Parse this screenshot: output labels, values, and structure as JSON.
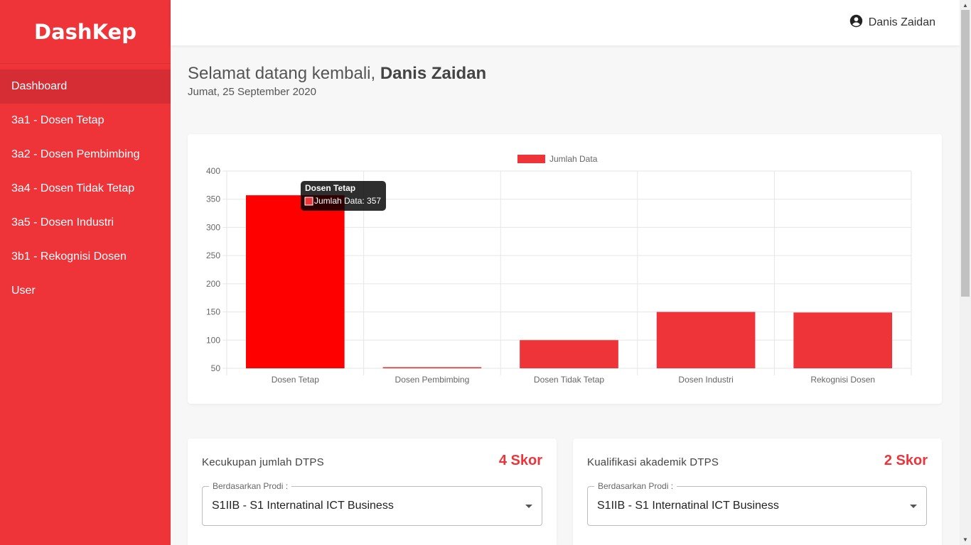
{
  "app": {
    "brand": "DashKep"
  },
  "sidebar": {
    "items": [
      {
        "label": "Dashboard",
        "active": true
      },
      {
        "label": "3a1 - Dosen Tetap"
      },
      {
        "label": "3a2 - Dosen Pembimbing"
      },
      {
        "label": "3a4 - Dosen Tidak Tetap"
      },
      {
        "label": "3a5 - Dosen Industri"
      },
      {
        "label": "3b1 - Rekognisi Dosen"
      },
      {
        "label": "User"
      }
    ]
  },
  "header": {
    "user_name": "Danis Zaidan",
    "user_icon": "account-circle-icon"
  },
  "welcome": {
    "greeting": "Selamat datang kembali,",
    "name": "Danis Zaidan",
    "date": "Jumat, 25 September 2020"
  },
  "chart_data": {
    "type": "bar",
    "categories": [
      "Dosen Tetap",
      "Dosen Pembimbing",
      "Dosen Tidak Tetap",
      "Dosen Industri",
      "Rekognisi Dosen"
    ],
    "series": [
      {
        "name": "Jumlah Data",
        "values": [
          357,
          52,
          100,
          150,
          149
        ]
      }
    ],
    "ylim": [
      50,
      400
    ],
    "yticks": [
      50,
      100,
      150,
      200,
      250,
      300,
      350,
      400
    ],
    "grid": true,
    "legend": "top-center",
    "color": "#ee3339",
    "highlight_color": "#ff0000",
    "tooltip": {
      "title": "Dosen Tetap",
      "label": "Jumlah Data: 357"
    }
  },
  "cards": [
    {
      "title": "Kecukupan jumlah DTPS",
      "score": "4 Skor",
      "select_legend": "Berdasarkan Prodi :",
      "select_value": "S1IIB - S1 Internatinal ICT Business"
    },
    {
      "title": "Kualifikasi akademik DTPS",
      "score": "2 Skor",
      "select_legend": "Berdasarkan Prodi :",
      "select_value": "S1IIB - S1 Internatinal ICT Business"
    }
  ],
  "colors": {
    "primary": "#ee3339",
    "sidebar_active": "#d62c33"
  }
}
